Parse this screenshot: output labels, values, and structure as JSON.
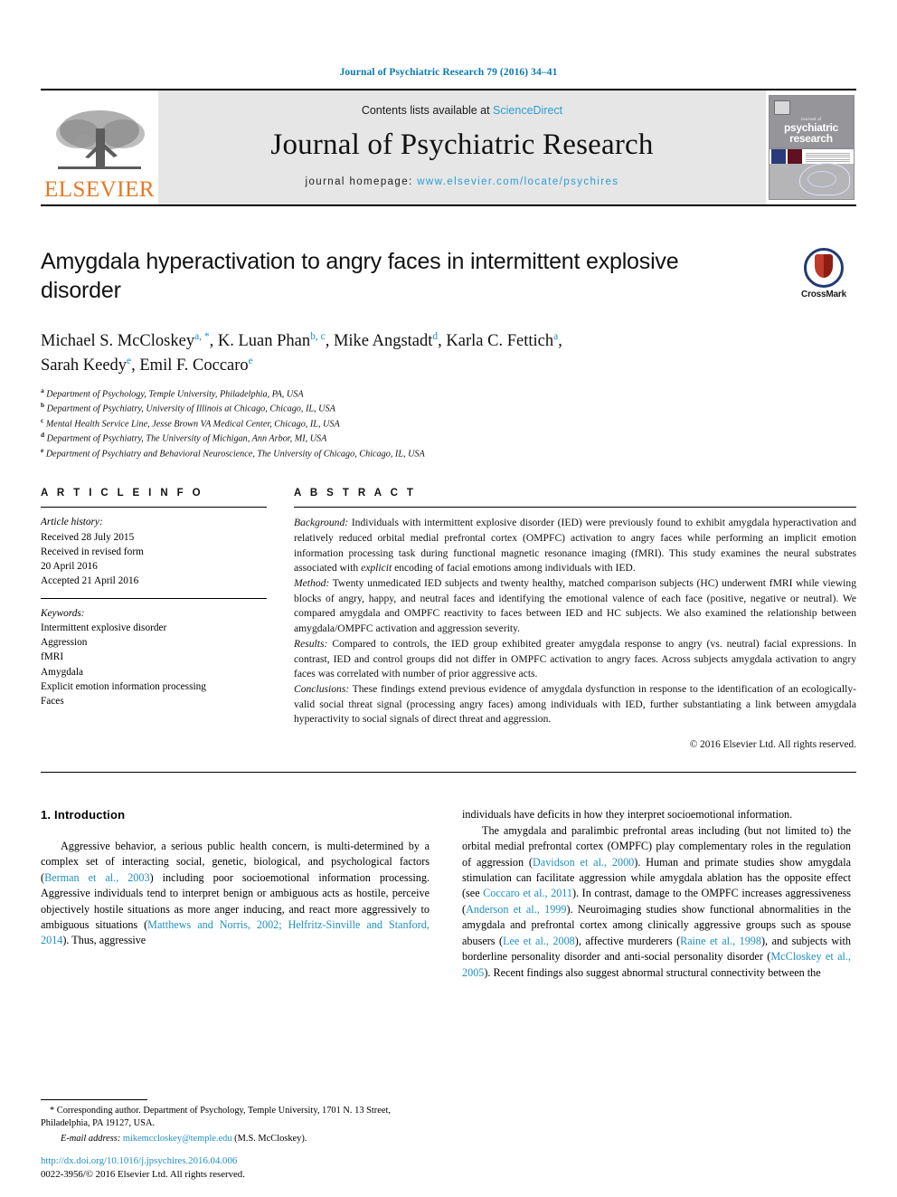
{
  "running_head": "Journal of Psychiatric Research 79 (2016) 34–41",
  "masthead": {
    "contents_prefix": "Contents lists available at ",
    "sciencedirect": "ScienceDirect",
    "journal_name": "Journal of Psychiatric Research",
    "homepage_prefix": "journal homepage: ",
    "homepage_url": "www.elsevier.com/locate/psychires",
    "publisher_wordmark": "ELSEVIER",
    "cover_kicker": "Journal of",
    "cover_title_line1": "psychiatric",
    "cover_title_line2": "research",
    "accent_blue": "#2b9ed4",
    "accent_orange": "#E87722"
  },
  "article": {
    "title": "Amygdala hyperactivation to angry faces in intermittent explosive disorder",
    "crossmark_label": "CrossMark",
    "authors_line1": "Michael S. McCloskey",
    "authors": [
      {
        "name": "Michael S. McCloskey",
        "sup": "a, *"
      },
      {
        "name": "K. Luan Phan",
        "sup": "b, c"
      },
      {
        "name": "Mike Angstadt",
        "sup": "d"
      },
      {
        "name": "Karla C. Fettich",
        "sup": "a"
      },
      {
        "name": "Sarah Keedy",
        "sup": "e"
      },
      {
        "name": "Emil F. Coccaro",
        "sup": "e"
      }
    ],
    "affiliations": [
      {
        "label": "a",
        "text": "Department of Psychology, Temple University, Philadelphia, PA, USA"
      },
      {
        "label": "b",
        "text": "Department of Psychiatry, University of Illinois at Chicago, Chicago, IL, USA"
      },
      {
        "label": "c",
        "text": "Mental Health Service Line, Jesse Brown VA Medical Center, Chicago, IL, USA"
      },
      {
        "label": "d",
        "text": "Department of Psychiatry, The University of Michigan, Ann Arbor, MI, USA"
      },
      {
        "label": "e",
        "text": "Department of Psychiatry and Behavioral Neuroscience, The University of Chicago, Chicago, IL, USA"
      }
    ]
  },
  "article_info": {
    "heading": "A R T I C L E   I N F O",
    "history_label": "Article history:",
    "history": [
      "Received 28 July 2015",
      "Received in revised form",
      "20 April 2016",
      "Accepted 21 April 2016"
    ],
    "keywords_label": "Keywords:",
    "keywords": [
      "Intermittent explosive disorder",
      "Aggression",
      "fMRI",
      "Amygdala",
      "Explicit emotion information processing",
      "Faces"
    ]
  },
  "abstract": {
    "heading": "A B S T R A C T",
    "background_label": "Background:",
    "background_text": " Individuals with intermittent explosive disorder (IED) were previously found to exhibit amygdala hyperactivation and relatively reduced orbital medial prefrontal cortex (OMPFC) activation to angry faces while performing an implicit emotion information processing task during functional magnetic resonance imaging (fMRI). This study examines the neural substrates associated with ",
    "background_em": "explicit",
    "background_tail": " encoding of facial emotions among individuals with IED.",
    "method_label": "Method:",
    "method_text": " Twenty unmedicated IED subjects and twenty healthy, matched comparison subjects (HC) underwent fMRI while viewing blocks of angry, happy, and neutral faces and identifying the emotional valence of each face (positive, negative or neutral). We compared amygdala and OMPFC reactivity to faces between IED and HC subjects. We also examined the relationship between amygdala/OMPFC activation and aggression severity.",
    "results_label": "Results:",
    "results_text": " Compared to controls, the IED group exhibited greater amygdala response to angry (vs. neutral) facial expressions. In contrast, IED and control groups did not differ in OMPFC activation to angry faces. Across subjects amygdala activation to angry faces was correlated with number of prior aggressive acts.",
    "conclusions_label": "Conclusions:",
    "conclusions_text": " These findings extend previous evidence of amygdala dysfunction in response to the identification of an ecologically-valid social threat signal (processing angry faces) among individuals with IED, further substantiating a link between amygdala hyperactivity to social signals of direct threat and aggression.",
    "copyright": "© 2016 Elsevier Ltd. All rights reserved."
  },
  "body": {
    "intro_heading": "1. Introduction",
    "left_para1_a": "Aggressive behavior, a serious public health concern, is multi-determined by a complex set of interacting social, genetic, biological, and psychological factors (",
    "left_ref1": "Berman et al., 2003",
    "left_para1_b": ") including poor socioemotional information processing. Aggressive individuals tend to interpret benign or ambiguous acts as hostile, perceive objectively hostile situations as more anger inducing, and react more aggressively to ambiguous situations (",
    "left_ref2": "Matthews and Norris, 2002; Helfritz-Sinville and Stanford, 2014",
    "left_para1_c": "). Thus, aggressive",
    "right_para1_cont": "individuals have deficits in how they interpret socioemotional information.",
    "right_para2_a": "The amygdala and paralimbic prefrontal areas including (but not limited to) the orbital medial prefrontal cortex (OMPFC) play complementary roles in the regulation of aggression (",
    "right_ref1": "Davidson et al., 2000",
    "right_para2_b": "). Human and primate studies show amygdala stimulation can facilitate aggression while amygdala ablation has the opposite effect (see ",
    "right_ref2": "Coccaro et al., 2011",
    "right_para2_c": "). In contrast, damage to the OMPFC increases aggressiveness (",
    "right_ref3": "Anderson et al., 1999",
    "right_para2_d": "). Neuroimaging studies show functional abnormalities in the amygdala and prefrontal cortex among clinically aggressive groups such as spouse abusers (",
    "right_ref4": "Lee et al., 2008",
    "right_para2_e": "), affective murderers (",
    "right_ref5": "Raine et al., 1998",
    "right_para2_f": "), and subjects with borderline personality disorder and anti-social personality disorder (",
    "right_ref6": "McCloskey et al., 2005",
    "right_para2_g": "). Recent findings also suggest abnormal structural connectivity between the"
  },
  "footer": {
    "corresponding_marker": "*",
    "corresponding_text": " Corresponding author. Department of Psychology, Temple University, 1701 N. 13 Street, Philadelphia, PA 19127, USA.",
    "email_label": "E-mail address:",
    "email": "mikemccloskey@temple.edu",
    "email_suffix": " (M.S. McCloskey).",
    "doi": "http://dx.doi.org/10.1016/j.jpsychires.2016.04.006",
    "issn_line": "0022-3956/© 2016 Elsevier Ltd. All rights reserved."
  }
}
